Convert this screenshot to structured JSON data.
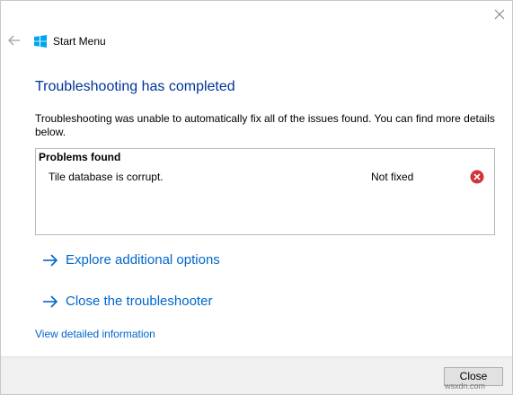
{
  "window": {
    "app_title": "Start Menu"
  },
  "content": {
    "heading": "Troubleshooting has completed",
    "description": "Troubleshooting was unable to automatically fix all of the issues found. You can find more details below."
  },
  "problems": {
    "header": "Problems found",
    "items": [
      {
        "name": "Tile database is corrupt.",
        "status": "Not fixed",
        "status_icon": "error-icon"
      }
    ]
  },
  "actions": {
    "explore_label": "Explore additional options",
    "close_troubleshooter_label": "Close the troubleshooter",
    "detail_link": "View detailed information"
  },
  "footer": {
    "close_label": "Close"
  },
  "watermark": "wsxdn.com",
  "colors": {
    "heading": "#003399",
    "link": "#0066cc",
    "error": "#d13438",
    "windows_logo": "#00a4ef"
  }
}
